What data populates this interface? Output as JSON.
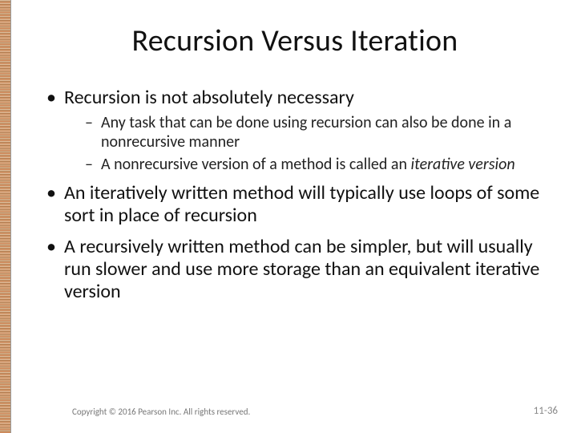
{
  "title": "Recursion Versus Iteration",
  "bullets": {
    "b1": {
      "text": "Recursion is not absolutely necessary",
      "sub": {
        "s1": "Any task that can be done using recursion can also be done in a nonrecursive manner",
        "s2_a": "A nonrecursive version of a method is called an ",
        "s2_b": "iterative version"
      }
    },
    "b2": "An iteratively written method will typically use loops of some sort in place of recursion",
    "b3": "A recursively written method can be simpler, but will usually run slower and use more storage than an equivalent iterative version"
  },
  "footer": {
    "copyright": "Copyright © 2016 Pearson Inc. All rights reserved.",
    "page": "11-36"
  }
}
